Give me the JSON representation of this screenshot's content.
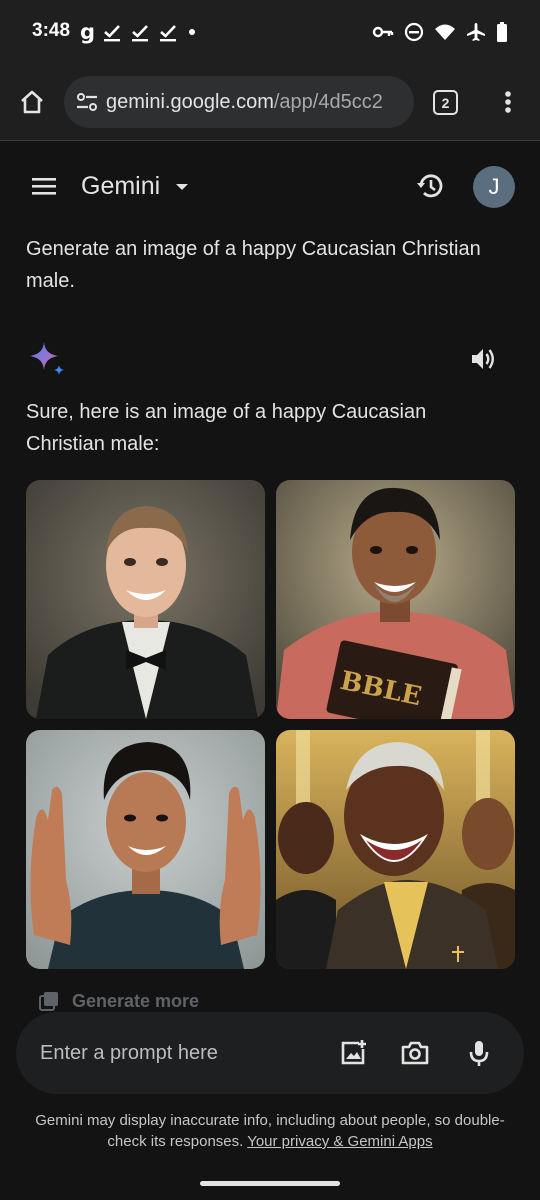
{
  "status_bar": {
    "time": "3:48",
    "left_icons": [
      "g-app-icon",
      "check-icon",
      "check-icon",
      "check-icon",
      "dot-icon"
    ],
    "right_icons": [
      "vpn-key-icon",
      "do-not-disturb-icon",
      "wifi-icon",
      "airplane-icon",
      "battery-icon"
    ]
  },
  "browser": {
    "url_domain": "gemini.google.com",
    "url_path": "/app/4d5cc2",
    "tab_count": "2"
  },
  "header": {
    "title": "Gemini",
    "avatar_initial": "J"
  },
  "conversation": {
    "user_prompt": "Generate an image of a happy Caucasian Christian male.",
    "response_text": "Sure, here is an image of a happy Caucasian Christian male:",
    "images": [
      {
        "icon": "portrait-man-tuxedo"
      },
      {
        "icon": "portrait-man-holding-bible",
        "book_text": "BBLE"
      },
      {
        "icon": "portrait-man-praying-hands"
      },
      {
        "icon": "portrait-men-laughing-church"
      }
    ],
    "generate_more_label": "Generate more"
  },
  "input": {
    "placeholder": "Enter a prompt here"
  },
  "footer": {
    "disclaimer_prefix": "Gemini may display inaccurate info, including about people, so double-check its responses. ",
    "privacy_link": "Your privacy & Gemini Apps"
  },
  "colors": {
    "background": "#131314",
    "chrome": "#1f1f1f",
    "sparkle_gradient": [
      "#4285f4",
      "#9b72cb",
      "#d96570"
    ]
  }
}
